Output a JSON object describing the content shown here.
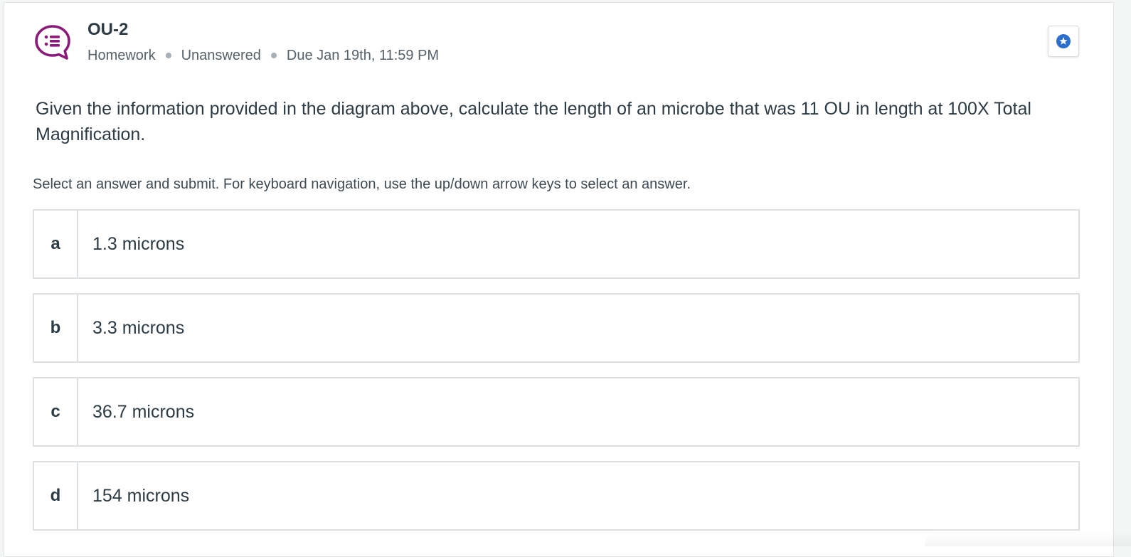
{
  "question": {
    "title": "OU-2",
    "type": "Homework",
    "status": "Unanswered",
    "due": "Due Jan 19th, 11:59 PM",
    "prompt": "Given the information provided in the diagram above, calculate the length of an microbe that was 11 OU in length at 100X Total Magnification.",
    "icon": "multiple-choice-bubble-icon",
    "accent_color": "#8b1a7a"
  },
  "instructions": "Select an answer and submit. For keyboard navigation, use the up/down arrow keys to select an answer.",
  "star_button": {
    "icon": "star-icon",
    "color": "#2c6ecb"
  },
  "options": [
    {
      "letter": "a",
      "text": "1.3 microns"
    },
    {
      "letter": "b",
      "text": "3.3 microns"
    },
    {
      "letter": "c",
      "text": "36.7 microns"
    },
    {
      "letter": "d",
      "text": "154 microns"
    }
  ]
}
